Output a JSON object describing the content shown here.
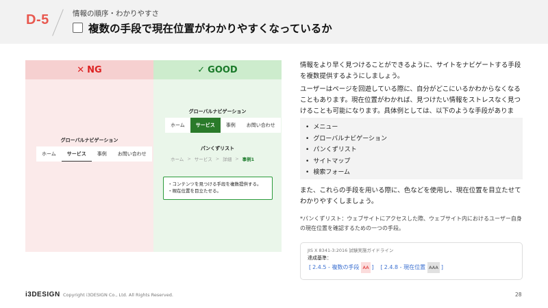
{
  "header": {
    "code": "D-5",
    "category": "情報の順序・わかりやすさ",
    "title": "複数の手段で現在位置がわかりやすくなっているか"
  },
  "ng_panel": {
    "mark": "✕",
    "label": "NG",
    "nav_title": "グローバルナビゲーション",
    "nav_items": [
      "ホーム",
      "サービス",
      "事例",
      "お問い合わせ"
    ],
    "active_index": 1
  },
  "good_panel": {
    "mark": "✓",
    "label": "GOOD",
    "nav_title": "グローバルナビゲーション",
    "nav_items": [
      "ホーム",
      "サービス",
      "事例",
      "お問い合わせ"
    ],
    "active_index": 1,
    "breadcrumb_title": "パンくずリスト",
    "breadcrumb": [
      "ホーム",
      "サービス",
      "詳細",
      "事例1"
    ],
    "breadcrumb_sep": ">",
    "notes": [
      "・コンテンツを見つける手段を複数提供する。",
      "・現在位置を目立たせる。"
    ]
  },
  "content": {
    "para1": "情報をより早く見つけることができるように、サイトをナビゲートする手段を複数提供するようにしましょう。",
    "para2": "ユーザーはページを回遊している際に、自分がどこにいるかわからなくなることもあります。現在位置がわかれば、見つけたい情報をストレスなく見つけることも可能になります。具体例としては、以下のような手段があります。",
    "list": [
      "メニュー",
      "グローバルナビゲーション",
      "パンくずリスト",
      "サイトマップ",
      "検索フォーム"
    ],
    "para3": "また、これらの手段を用いる際に、色などを使用し、現在位置を目立たせてわかりやすくしましょう。",
    "footnote": "*パンくずリスト：ウェブサイトにアクセスした際、ウェブサイト内におけるユーザー自身の現在位置を確認するための一つの手段。"
  },
  "reference": {
    "source": "JIS X 8341-3:2016 試験実施ガイドライン",
    "label": "達成基準：",
    "links": [
      {
        "text": "2.4.5 - 複数の手段",
        "level": "AA"
      },
      {
        "text": "2.4.8 - 現在位置",
        "level": "AAA"
      }
    ]
  },
  "footer": {
    "logo": "i3DESIGN",
    "copyright": "Copyright i3DESIGN Co., Ltd. All Rights Reserved.",
    "page": "28"
  },
  "colors": {
    "accent_red": "#e8584f",
    "good_green": "#2a7a2a",
    "link_blue": "#3a6fd0"
  }
}
